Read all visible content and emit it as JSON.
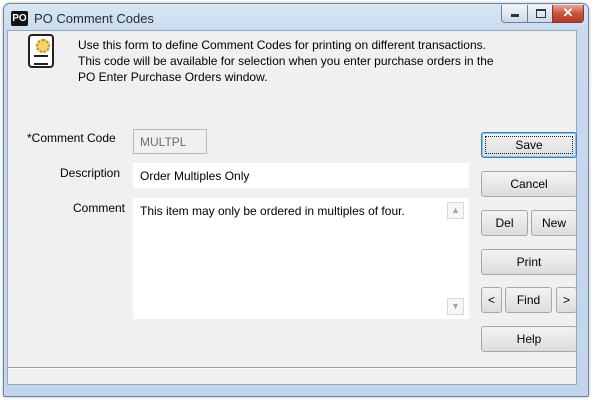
{
  "window": {
    "app_icon": "PO",
    "title": "PO Comment Codes",
    "minimize_icon": "minimize-icon",
    "maximize_icon": "maximize-icon",
    "close_glyph": "✕"
  },
  "info": {
    "icon": "document-gear-icon",
    "lines": [
      "Use this form to define Comment Codes for printing on different transactions.",
      "This code will be available for selection when you enter purchase orders in the",
      "PO Enter Purchase Orders window."
    ]
  },
  "form": {
    "comment_code_label": "*Comment Code",
    "comment_code_value": "MULTPL",
    "description_label": "Description",
    "description_value": "Order Multiples Only",
    "comment_label": "Comment",
    "comment_value": "This item may only be ordered in multiples of four."
  },
  "buttons": {
    "save": "Save",
    "cancel": "Cancel",
    "del": "Del",
    "new": "New",
    "print": "Print",
    "prev": "<",
    "find": "Find",
    "next": ">",
    "help": "Help"
  },
  "colors": {
    "title_bar": "#c8d9ee",
    "client_bg": "#f0f0f0",
    "close_button": "#c7543b",
    "default_button_border": "#3c7fb1"
  }
}
